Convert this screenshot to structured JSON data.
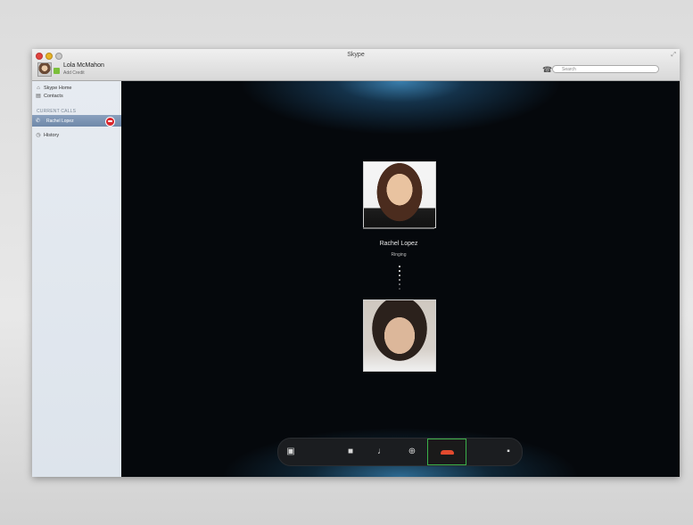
{
  "window": {
    "title": "Skype"
  },
  "account": {
    "name": "Lola McMahon",
    "credit_link": "Add Credit"
  },
  "search": {
    "placeholder": "Search"
  },
  "sidebar": {
    "items": [
      {
        "label": "Skype Home",
        "icon": "home-icon"
      },
      {
        "label": "Contacts",
        "icon": "contacts-icon"
      }
    ],
    "section_header": "CURRENT CALLS",
    "current_call": {
      "label": "Rachel Lopez",
      "icon": "call-icon"
    },
    "history": {
      "label": "History",
      "icon": "history-icon"
    }
  },
  "call": {
    "callee_name": "Rachel Lopez",
    "status": "Ringing"
  },
  "controls": [
    {
      "name": "show-sidebar-button",
      "icon": "sidebar-icon"
    },
    {
      "name": "video-button",
      "icon": "camera-icon"
    },
    {
      "name": "mute-button",
      "icon": "microphone-icon"
    },
    {
      "name": "add-participant-button",
      "icon": "plus-icon"
    },
    {
      "name": "end-call-button",
      "icon": "hangup-icon"
    },
    {
      "name": "fullscreen-video-button",
      "icon": "picture-in-picture-icon"
    }
  ],
  "colors": {
    "end_call_border": "#3bb04a",
    "hangup": "#e24a2e",
    "sidebar_selected": "#7a91b1"
  }
}
